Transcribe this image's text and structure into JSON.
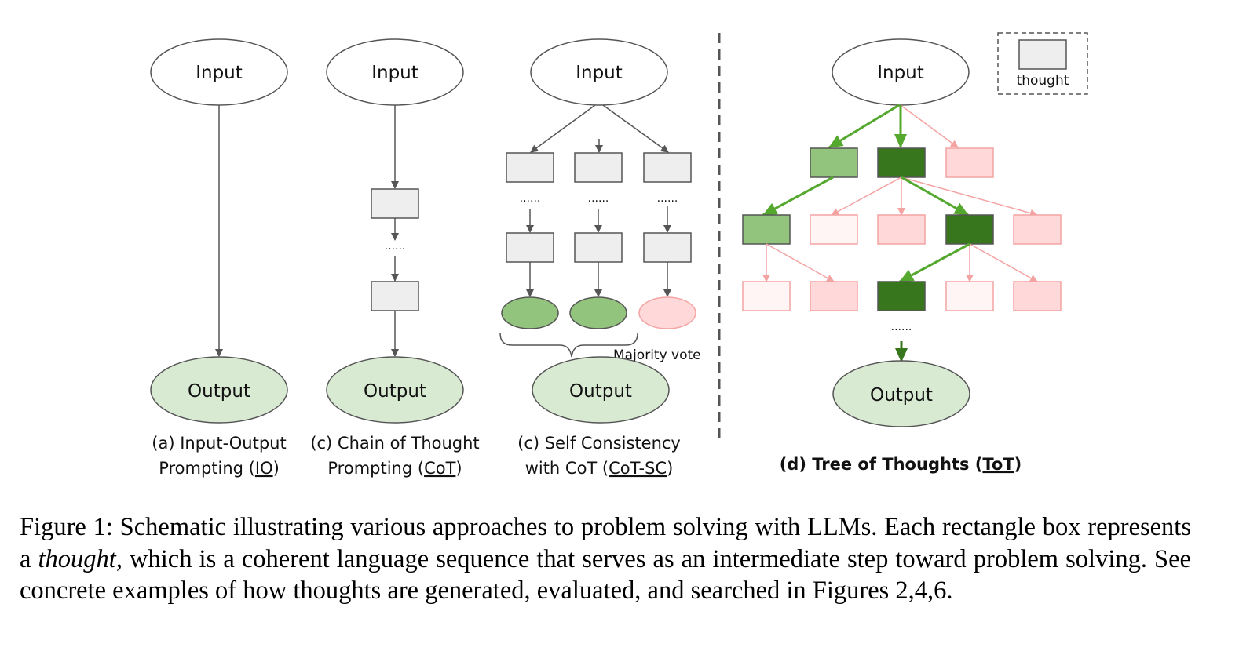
{
  "colors": {
    "edge_gray": "#555555",
    "thought_fill": "#eeeeee",
    "output_fill": "#d9ead3",
    "green_light": "#93c47d",
    "green_dark": "#38761d",
    "green_arrow": "#53a82d",
    "pink_fill": "#ffd9d9",
    "pink_pale": "#fff5f5",
    "pink_edge": "#f4a3a3"
  },
  "nodes": {
    "input_label": "Input",
    "output_label": "Output",
    "ellipsis": "......"
  },
  "panels": {
    "io": {
      "caption_line1": "(a) Input-Output",
      "caption_line2_pre": "Prompting (",
      "caption_line2_abbr": "IO",
      "caption_line2_post": ")"
    },
    "cot": {
      "caption_line1": "(c) Chain of Thought",
      "caption_line2_pre": "Prompting (",
      "caption_line2_abbr": "CoT",
      "caption_line2_post": ")"
    },
    "cot_sc": {
      "caption_line1": "(c) Self Consistency",
      "caption_line2_pre": "with CoT (",
      "caption_line2_abbr": "CoT-SC",
      "caption_line2_post": ")",
      "vote_label": "Majority vote"
    },
    "tot": {
      "caption_pre": "(d) Tree of Thoughts (",
      "caption_abbr": "ToT",
      "caption_post": ")"
    }
  },
  "legend": {
    "label": "thought"
  },
  "caption": {
    "part1": "Figure 1: Schematic illustrating various approaches to problem solving with LLMs. Each rectangle box represents a ",
    "italic": "thought",
    "part2": ", which is a coherent language sequence that serves as an intermediate step toward problem solving. See concrete examples of how thoughts are generated, evaluated, and searched in Figures 2,4,6."
  }
}
